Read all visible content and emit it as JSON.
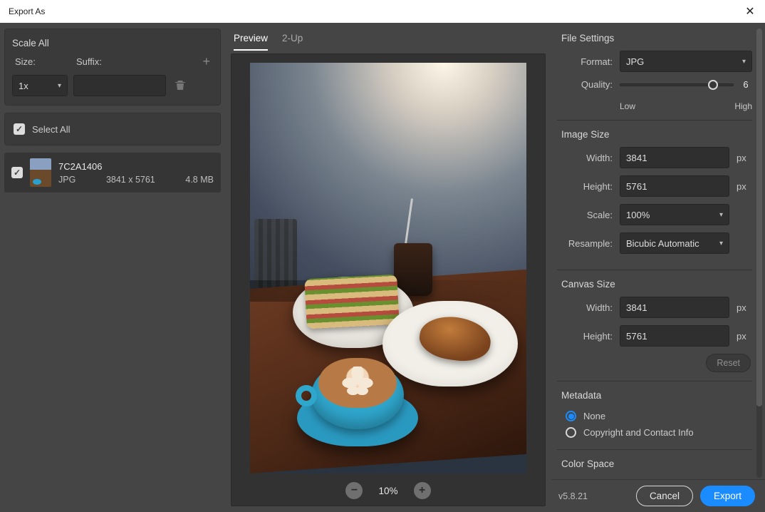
{
  "window": {
    "title": "Export As"
  },
  "left": {
    "scale_all_title": "Scale All",
    "size_label": "Size:",
    "suffix_label": "Suffix:",
    "size_value": "1x",
    "suffix_value": "",
    "select_all_label": "Select All",
    "asset": {
      "name": "7C2A1406",
      "format": "JPG",
      "dims": "3841 x 5761",
      "filesize": "4.8 MB"
    }
  },
  "center": {
    "tabs": {
      "preview": "Preview",
      "two_up": "2-Up"
    },
    "zoom": "10%"
  },
  "right": {
    "file_settings": {
      "title": "File Settings",
      "format_label": "Format:",
      "format_value": "JPG",
      "quality_label": "Quality:",
      "quality_value": "6",
      "low": "Low",
      "high": "High"
    },
    "image_size": {
      "title": "Image Size",
      "width_label": "Width:",
      "width_value": "3841",
      "height_label": "Height:",
      "height_value": "5761",
      "scale_label": "Scale:",
      "scale_value": "100%",
      "resample_label": "Resample:",
      "resample_value": "Bicubic Automatic",
      "px": "px"
    },
    "canvas_size": {
      "title": "Canvas Size",
      "width_label": "Width:",
      "width_value": "3841",
      "height_label": "Height:",
      "height_value": "5761",
      "px": "px",
      "reset": "Reset"
    },
    "metadata": {
      "title": "Metadata",
      "none": "None",
      "copyright": "Copyright and Contact Info"
    },
    "color_space": {
      "title": "Color Space"
    }
  },
  "footer": {
    "version": "v5.8.21",
    "cancel": "Cancel",
    "export": "Export"
  }
}
